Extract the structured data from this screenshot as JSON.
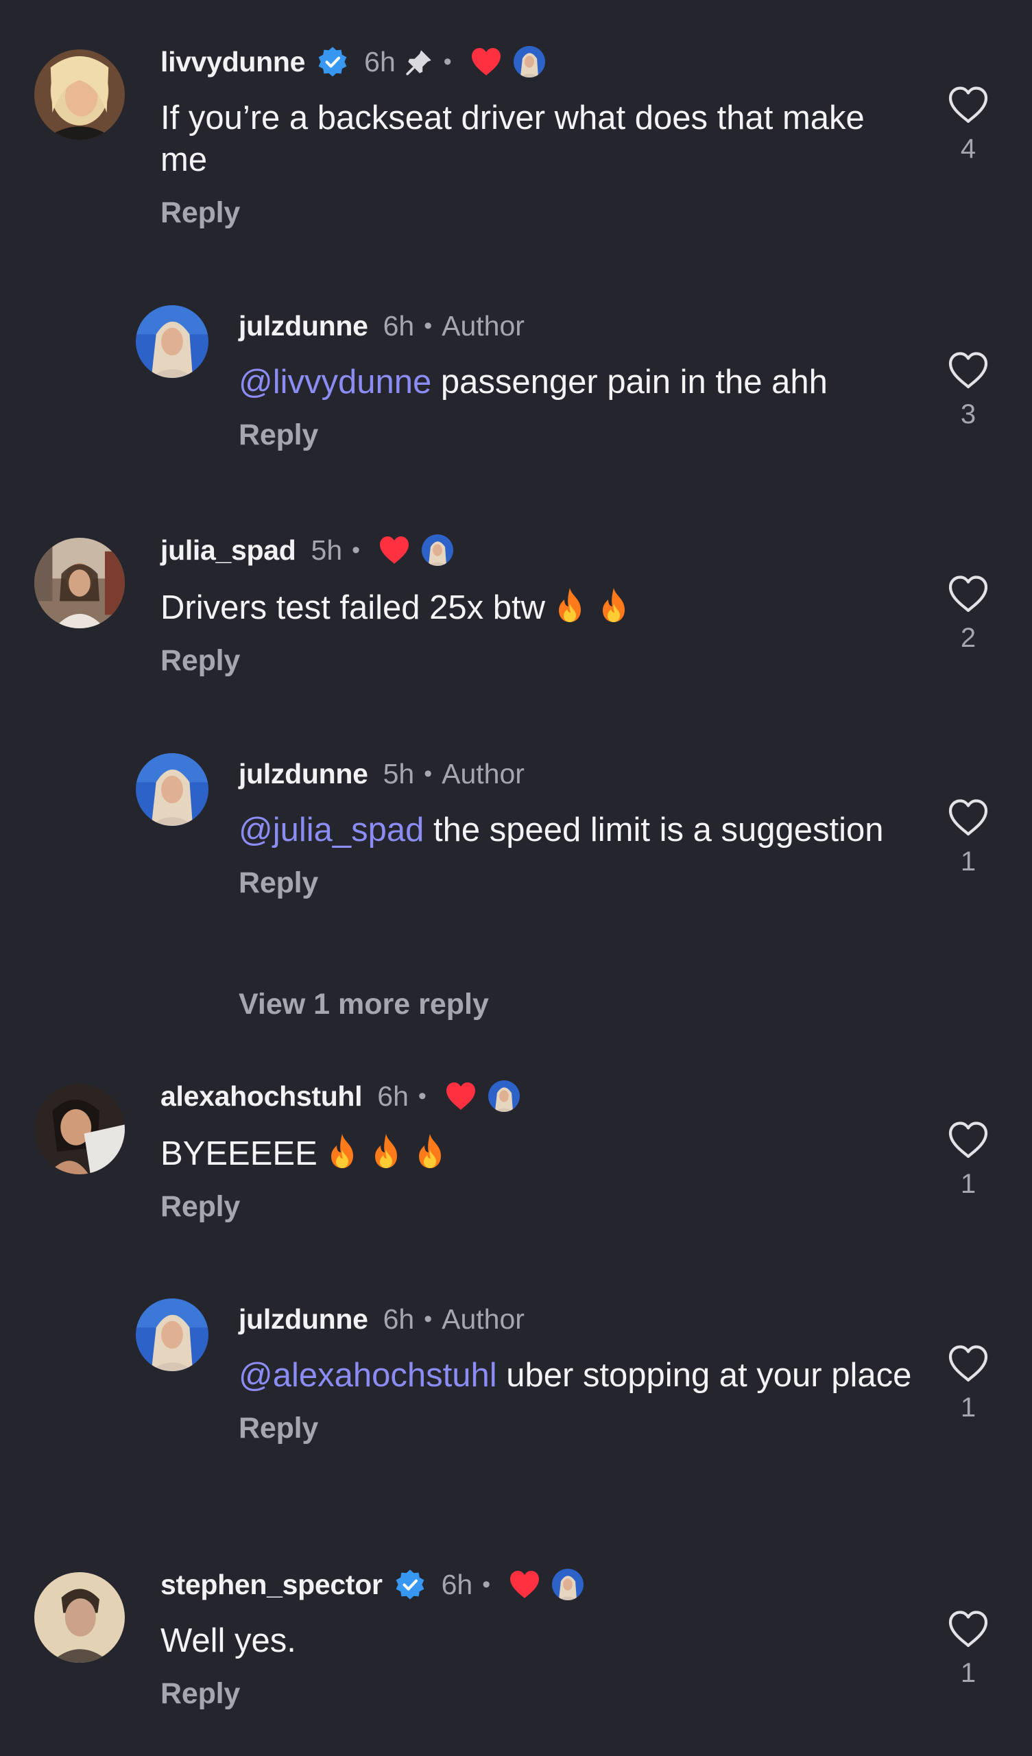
{
  "comments": [
    {
      "username": "livvydunne",
      "verified": true,
      "time": "6h",
      "pinned": true,
      "creator_liked": true,
      "is_author": false,
      "text_parts": [
        {
          "t": "If you’re a backseat driver what does that make me",
          "mention": false
        }
      ],
      "emojis": [],
      "reply_label": "Reply",
      "likes": "4",
      "avatar_icon": "avatar-blonde-woman",
      "indent": false
    },
    {
      "username": "julzdunne",
      "verified": false,
      "time": "6h",
      "pinned": false,
      "creator_liked": false,
      "is_author": true,
      "author_label": "Author",
      "text_parts": [
        {
          "t": "@livvydunne",
          "mention": true
        },
        {
          "t": " passenger pain in the ahh",
          "mention": false
        }
      ],
      "emojis": [],
      "reply_label": "Reply",
      "likes": "3",
      "avatar_icon": "avatar-julzdunne",
      "indent": true
    },
    {
      "username": "julia_spad",
      "verified": false,
      "time": "5h",
      "pinned": false,
      "creator_liked": true,
      "is_author": false,
      "text_parts": [
        {
          "t": "Drivers test failed 25x btw",
          "mention": false
        }
      ],
      "emojis": [
        "fire-emoji",
        "fire-emoji"
      ],
      "reply_label": "Reply",
      "likes": "2",
      "avatar_icon": "avatar-julia-spad",
      "indent": false
    },
    {
      "username": "julzdunne",
      "verified": false,
      "time": "5h",
      "pinned": false,
      "creator_liked": false,
      "is_author": true,
      "author_label": "Author",
      "text_parts": [
        {
          "t": "@julia_spad",
          "mention": true
        },
        {
          "t": " the speed limit is a suggestion",
          "mention": false
        }
      ],
      "emojis": [],
      "reply_label": "Reply",
      "likes": "1",
      "avatar_icon": "avatar-julzdunne",
      "indent": true
    },
    {
      "username": "alexahochstuhl",
      "verified": false,
      "time": "6h",
      "pinned": false,
      "creator_liked": true,
      "is_author": false,
      "text_parts": [
        {
          "t": "BYEEEEE",
          "mention": false
        }
      ],
      "emojis": [
        "fire-emoji",
        "fire-emoji",
        "fire-emoji"
      ],
      "reply_label": "Reply",
      "likes": "1",
      "avatar_icon": "avatar-alexahochstuhl",
      "indent": false
    },
    {
      "username": "julzdunne",
      "verified": false,
      "time": "6h",
      "pinned": false,
      "creator_liked": false,
      "is_author": true,
      "author_label": "Author",
      "text_parts": [
        {
          "t": "@alexahochstuhl",
          "mention": true
        },
        {
          "t": " uber stopping at your place",
          "mention": false
        }
      ],
      "emojis": [],
      "reply_label": "Reply",
      "likes": "1",
      "avatar_icon": "avatar-julzdunne",
      "indent": true
    },
    {
      "username": "stephen_spector",
      "verified": true,
      "time": "6h",
      "pinned": false,
      "creator_liked": true,
      "is_author": false,
      "text_parts": [
        {
          "t": "Well yes.",
          "mention": false
        }
      ],
      "emojis": [],
      "reply_label": "Reply",
      "likes": "1",
      "avatar_icon": "avatar-stephen-spector",
      "indent": false
    }
  ],
  "view_more_replies": "View 1 more reply",
  "colors": {
    "background": "#25262d",
    "text": "#f2f2f4",
    "muted": "#a4a7b0",
    "mention": "#8c8cf5",
    "verified_blue": "#3897f0",
    "heart_red": "#ff3040"
  }
}
